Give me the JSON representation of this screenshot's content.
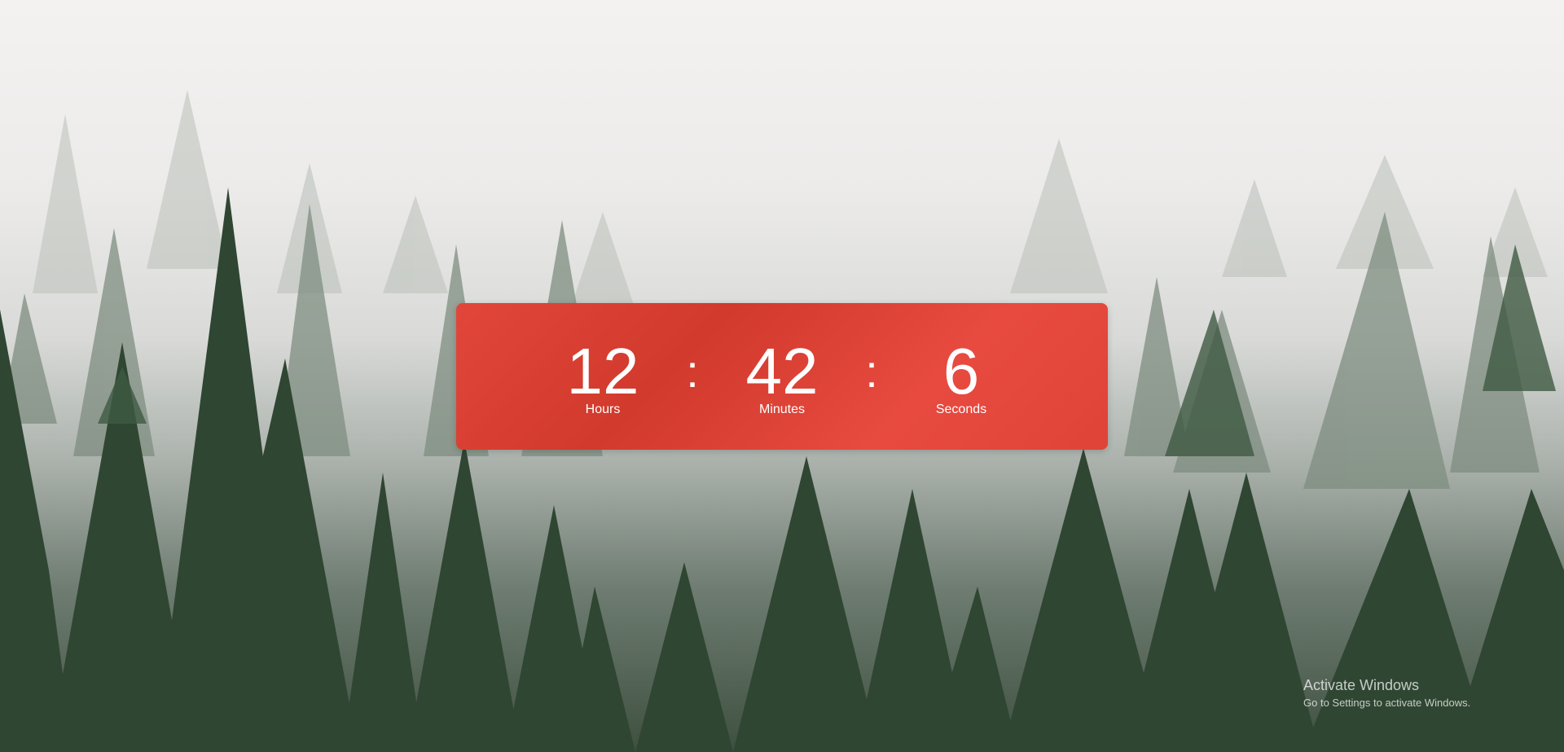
{
  "timer": {
    "hours": "12",
    "minutes": "42",
    "seconds": "6",
    "separator": ":",
    "labels": {
      "hours": "Hours",
      "minutes": "Minutes",
      "seconds": "Seconds"
    },
    "color": "#df4337"
  },
  "watermark": {
    "title": "Activate Windows",
    "subtitle": "Go to Settings to activate Windows."
  },
  "background": {
    "description_icon": "foggy-forest-image"
  }
}
